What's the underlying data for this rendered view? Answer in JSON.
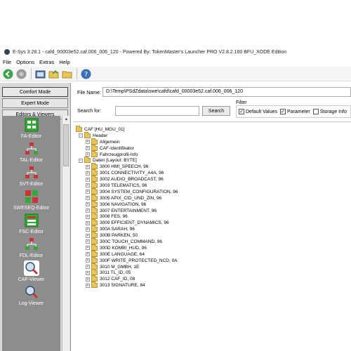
{
  "window": {
    "title": "E-Sys 3.28.1 - cafd_00003e52.caf.006_006_120  - Powered By: TokenMaster's Launcher PRO V2.8.2.160 BFU_XODE Edition"
  },
  "menu": [
    "File",
    "Options",
    "Extras",
    "Help"
  ],
  "toolbar": {
    "icons": [
      "back-icon",
      "disabled-icon",
      "connect-icon",
      "open-folder-icon",
      "folder-icon",
      "help-icon"
    ]
  },
  "sidebar": {
    "buttons": [
      "Comfort Mode",
      "Expert Mode",
      "Editors & Viewers"
    ],
    "tools": [
      "FA-Editor",
      "TAL-Editor",
      "SVT-Editor",
      "SWESEQ-Editor",
      "FSC-Editor",
      "FDL-Editor",
      "CAF-Viewer",
      "Log-Viewer"
    ],
    "selected_tool": "CAF-Viewer"
  },
  "file": {
    "label": "File Name:",
    "value": "D:\\Temp\\PSdZdata\\swe\\cafd\\cafd_00003e52.caf.006_006_120"
  },
  "search": {
    "label": "Search for:",
    "value": "",
    "button": "Search"
  },
  "filter": {
    "title": "Filter",
    "options": [
      {
        "label": "Default Values",
        "checked": true
      },
      {
        "label": "Parameter",
        "checked": true
      },
      {
        "label": "Storage Info",
        "checked": false
      }
    ]
  },
  "tree": {
    "root": "CAF [HU_MGU_01]",
    "header": {
      "label": "Header",
      "children": [
        "Allgemein",
        "CAF-Identifikator",
        "Fahrzeugprofil-Info"
      ]
    },
    "daten": {
      "label": "Daten [Layout: BYTE]",
      "children": [
        "3000 HMI_SPEECH, 96",
        "3001 CONNECTIVITY_A4A, 96",
        "3002 AUDIO_BROADCAST, 96",
        "3003 TELEMATICS, 96",
        "3004 SYSTEM_CONFIGURATION, 96",
        "3005 APIX_CID_UND_ZIN, 96",
        "3006 NAVIGATION, 96",
        "3007 ENTERTAINMENT, 96",
        "3008 FES, 96",
        "3009 EFFICIENT_DYNAMICS, 96",
        "300A SARAH, 96",
        "300B PARKEN, 50",
        "300C TOUCH_COMMAND, 96",
        "300D KOMBI_HUD, 96",
        "300E LANGUAGE, 64",
        "300F WRITE_PROTECTED_NCD, 0A",
        "3010 M_GMBH, 1E",
        "3011 TL_ID, 05",
        "3012 CAF_ID, 08",
        "3013 SIGNATURE, 84"
      ]
    }
  }
}
